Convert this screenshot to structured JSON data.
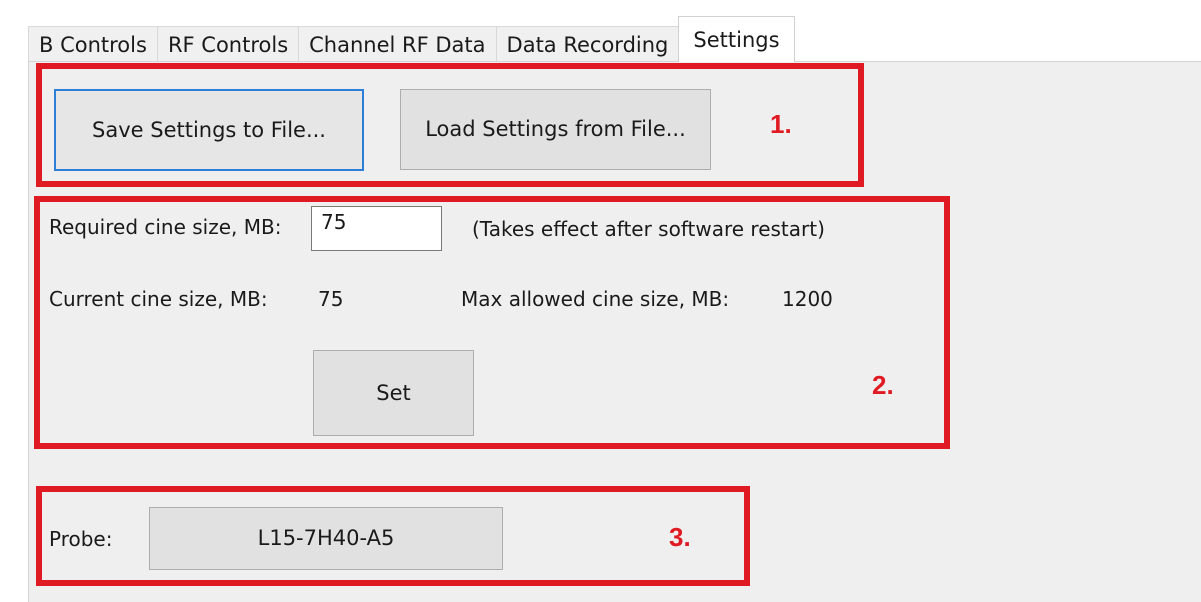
{
  "tabs": [
    {
      "label": "B Controls",
      "active": false
    },
    {
      "label": "RF Controls",
      "active": false
    },
    {
      "label": "Channel RF Data",
      "active": false
    },
    {
      "label": "Data Recording",
      "active": false
    },
    {
      "label": "Settings",
      "active": true
    }
  ],
  "section1": {
    "save_button_label": "Save Settings to File...",
    "load_button_label": "Load Settings from File...",
    "marker": "1."
  },
  "section2": {
    "required_label": "Required cine size, MB:",
    "required_value": "75",
    "note": "(Takes effect after software restart)",
    "current_label": "Current cine size, MB:",
    "current_value": "75",
    "max_label": "Max allowed cine size, MB:",
    "max_value": "1200",
    "set_button_label": "Set",
    "marker": "2."
  },
  "section3": {
    "probe_label": "Probe:",
    "probe_value": "L15-7H40-A5",
    "marker": "3."
  },
  "colors": {
    "annotation_red": "#e01a22",
    "focus_blue": "#2b7fd6",
    "panel_background": "#efefef"
  }
}
